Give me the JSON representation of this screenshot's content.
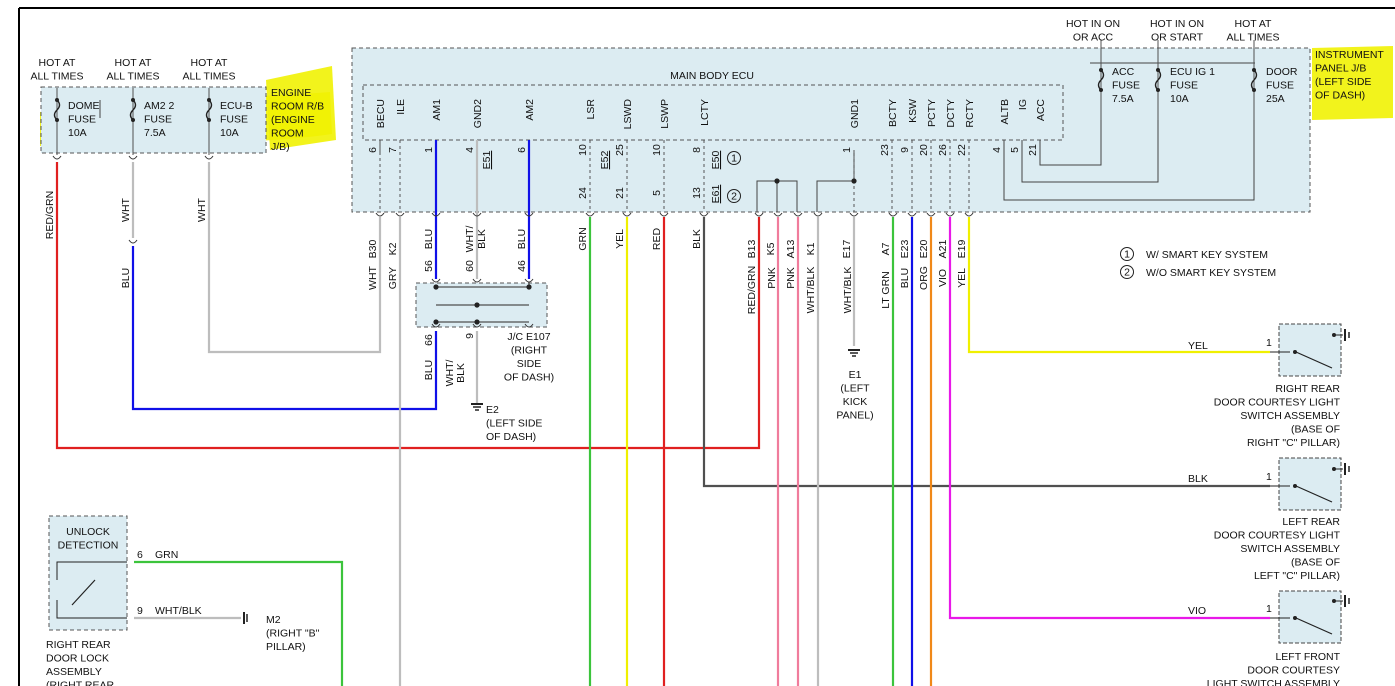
{
  "labels": {
    "hot_at_all_times": "HOT AT\nALL TIMES",
    "hot_in_on_or_acc": "HOT IN ON\nOR ACC",
    "hot_in_on_or_start": "HOT IN ON\nOR START",
    "main_body_ecu": "MAIN BODY ECU",
    "engine_room_rb": "ENGINE\nROOM R/B\n(ENGINE\nROOM\nJ/B)",
    "instrument_panel_jb": "INSTRUMENT\nPANEL J/B\n(LEFT SIDE\nOF DASH)",
    "legend_1": "W/ SMART KEY SYSTEM",
    "legend_2": "W/O SMART KEY SYSTEM",
    "jc": "J/C E107\n(RIGHT\nSIDE\nOF DASH)",
    "e2": "E2\n(LEFT SIDE\nOF DASH)",
    "e1": "E1\n(LEFT\nKICK\nPANEL)",
    "m2": "M2\n(RIGHT \"B\"\nPILLAR)",
    "unlock_detection": "UNLOCK\nDETECTION",
    "right_rear_door_lock": "RIGHT REAR\nDOOR LOCK\nASSEMBLY\n(RIGHT REAR",
    "rr_switch": "RIGHT REAR\nDOOR COURTESY LIGHT\nSWITCH ASSEMBLY\n(BASE OF\nRIGHT \"C\" PILLAR)",
    "lr_switch": "LEFT REAR\nDOOR COURTESY LIGHT\nSWITCH ASSEMBLY\n(BASE OF\nLEFT \"C\" PILLAR)",
    "lf_switch": "LEFT FRONT\nDOOR COURTESY\nLIGHT SWITCH ASSEMBLY"
  },
  "fuses": {
    "dome": "DOME\nFUSE\n10A",
    "am2": "AM2 2\nFUSE\n7.5A",
    "ecub": "ECU-B\nFUSE\n10A",
    "acc": "ACC\nFUSE\n7.5A",
    "ecu_ig1": "ECU IG 1\nFUSE\n10A",
    "door": "DOOR\nFUSE\n25A"
  },
  "ecu_pins": [
    "BECU",
    "ILE",
    "AM1",
    "GND2",
    "AM2",
    "LSR",
    "LSWD",
    "LSWP",
    "LCTY",
    "GND1",
    "BCTY",
    "KSW",
    "PCTY",
    "DCTY",
    "RCTY",
    "ALTB",
    "IG",
    "ACC"
  ],
  "pin_numbers_top": [
    "6",
    "7",
    "1",
    "4",
    "6",
    "10",
    "25",
    "10",
    "8",
    "1",
    "23",
    "9",
    "20",
    "26",
    "22",
    "4",
    "5",
    "21"
  ],
  "pin_numbers_bottom": [
    "24",
    "21",
    "5",
    "13"
  ],
  "connector_codes": [
    "E51",
    "E52",
    "E50",
    "E61"
  ],
  "bottom_connectors": [
    "B30",
    "K2",
    "B13",
    "K5",
    "A13",
    "K1",
    "E17",
    "A7",
    "E23",
    "E20",
    "A21",
    "E19"
  ],
  "wire_colors": [
    "RED/GRN",
    "WHT",
    "WHT",
    "BLU",
    "WHT",
    "GRY",
    "BLU",
    "WHT/\nBLK",
    "BLU",
    "GRN",
    "YEL",
    "RED",
    "BLK",
    "RED/GRN",
    "PNK",
    "PNK",
    "WHT/BLK",
    "WHT/BLK",
    "LT GRN",
    "BLU",
    "ORG",
    "VIO",
    "YEL"
  ],
  "jc_pins": [
    "56",
    "60",
    "46",
    "66",
    "9"
  ],
  "switch_wires": [
    "YEL",
    "BLK",
    "VIO",
    "GRN",
    "WHT/BLK"
  ],
  "switch_pins": [
    "1",
    "1",
    "1",
    "6",
    "9"
  ],
  "circle_marks": [
    "1",
    "2"
  ],
  "colors": {
    "red": "#e02020",
    "blue": "#1010e8",
    "green": "#3cc43c",
    "yellow": "#f0f000",
    "pink": "#f07c9c",
    "grey": "#bdbdbd",
    "dark": "#505050",
    "orange": "#f08818",
    "violet": "#e818e8",
    "highlight": "#f1f203",
    "box_fill": "#dcecf2"
  }
}
